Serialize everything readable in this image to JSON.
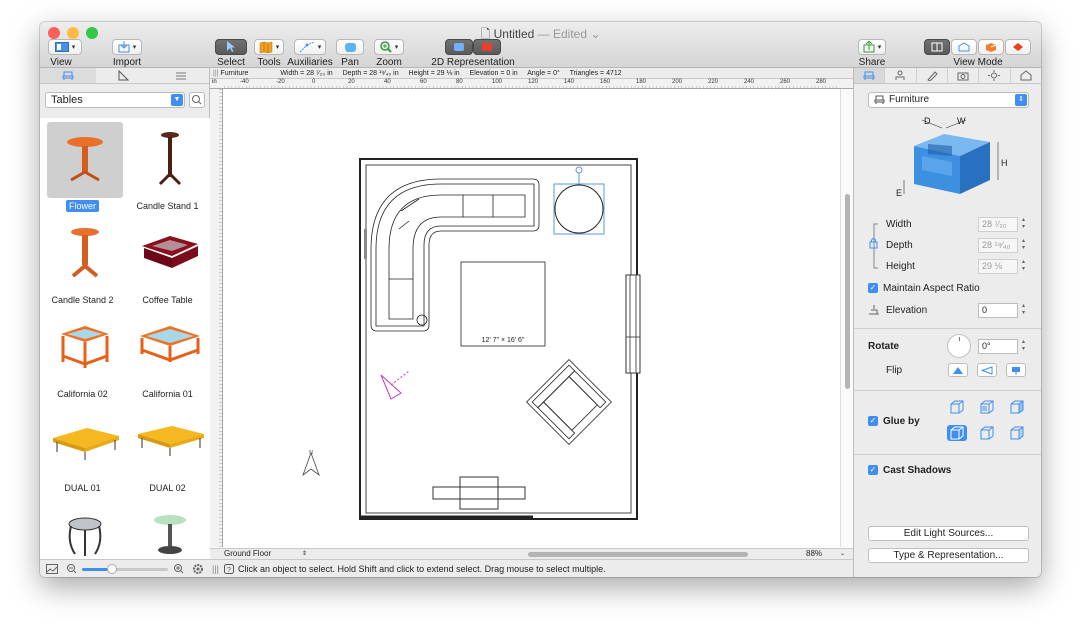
{
  "window": {
    "title": "Untitled",
    "status": "— Edited ⌄"
  },
  "toolbar": {
    "view_label": "View",
    "import_label": "Import",
    "select_label": "Select",
    "tools_label": "Tools",
    "auxiliaries_label": "Auxiliaries",
    "pan_label": "Pan",
    "zoom_label": "Zoom",
    "representation_label": "2D Representation",
    "share_label": "Share",
    "view_mode_label": "View Mode"
  },
  "library": {
    "category": "Tables",
    "items": [
      {
        "label": "Flower",
        "selected": true
      },
      {
        "label": "Candle Stand 1"
      },
      {
        "label": "Candle Stand 2"
      },
      {
        "label": "Coffee Table"
      },
      {
        "label": "California 02"
      },
      {
        "label": "California 01"
      },
      {
        "label": "DUAL 01"
      },
      {
        "label": "DUAL 02"
      },
      {
        "label": ""
      },
      {
        "label": ""
      }
    ]
  },
  "infobar": {
    "category": "Furniture",
    "width": "Width = 28 ⁷⁄₂₀ in",
    "depth": "Depth = 28 ¹⁹⁄₄₀ in",
    "height": "Height = 29 ⅛ in",
    "elevation": "Elevation = 0 in",
    "angle": "Angle = 0°",
    "triangles": "Triangles = 4712"
  },
  "ruler": {
    "unit": "in",
    "ticks": [
      "-40",
      "-20",
      "0",
      "20",
      "40",
      "60",
      "80",
      "100",
      "120",
      "140",
      "160",
      "180",
      "200",
      "220",
      "240",
      "260",
      "280"
    ]
  },
  "plan": {
    "room_label": "12' 7\" × 16' 6\""
  },
  "canvas_footer": {
    "floor": "Ground Floor",
    "zoom": "88%"
  },
  "status_bar": {
    "message": "Click an object to select. Hold Shift and click to extend select. Drag mouse to select multiple."
  },
  "inspector": {
    "type": "Furniture",
    "dim_labels": {
      "d": "D",
      "w": "W",
      "h": "H",
      "e": "E"
    },
    "width_label": "Width",
    "width_value": "28 ⁷⁄₂₀",
    "depth_label": "Depth",
    "depth_value": "28 ¹⁹⁄₄₀",
    "height_label": "Height",
    "height_value": "29 ⅛",
    "maintain_aspect": "Maintain Aspect Ratio",
    "elevation_label": "Elevation",
    "elevation_value": "0",
    "rotate_label": "Rotate",
    "rotate_value": "0°",
    "flip_label": "Flip",
    "glue_label": "Glue by",
    "cast_shadows": "Cast Shadows",
    "edit_light": "Edit Light Sources...",
    "type_repr": "Type & Representation..."
  },
  "colors": {
    "accent": "#3f8ef0",
    "selection": "#5b95e6",
    "chair_blue": "#3d8fe0",
    "furniture_orange": "#e8702a"
  }
}
